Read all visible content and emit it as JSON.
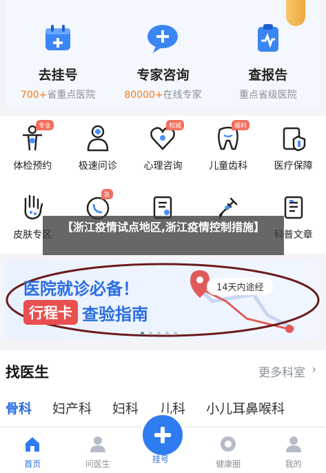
{
  "top_services": [
    {
      "title": "去挂号",
      "sub_highlight": "700+",
      "sub_text": "省重点医院",
      "icon": "calendar-plus-icon"
    },
    {
      "title": "专家咨询",
      "sub_highlight": "80000+",
      "sub_text": "在线专家",
      "icon": "chat-plus-icon"
    },
    {
      "title": "查报告",
      "sub_highlight": "",
      "sub_text": "重点省级医院",
      "icon": "report-icon"
    }
  ],
  "grid_items": [
    {
      "label": "体检预约",
      "badge": "专业",
      "icon": "body-check-icon"
    },
    {
      "label": "极速问诊",
      "badge": "",
      "icon": "doctor-icon"
    },
    {
      "label": "心理咨询",
      "badge": "权威",
      "icon": "heart-icon"
    },
    {
      "label": "儿童齿科",
      "badge": "福利",
      "icon": "tooth-icon"
    },
    {
      "label": "医疗保障",
      "badge": "",
      "icon": "shield-icon"
    },
    {
      "label": "皮肤专区",
      "badge": "",
      "icon": "hand-icon"
    },
    {
      "label": "",
      "badge": "急",
      "icon": "phone-icon"
    },
    {
      "label": "",
      "badge": "",
      "icon": "clipboard-icon"
    },
    {
      "label": "",
      "badge": "",
      "icon": "syringe-icon"
    },
    {
      "label": "科普文章",
      "badge": "",
      "icon": "article-icon"
    }
  ],
  "overlay_text": "【浙江疫情试点地区,浙江疫情控制措施】",
  "banner": {
    "line1": "医院就诊必备！",
    "tag": "行程卡",
    "line2": "查验指南",
    "pill": "14天内途经"
  },
  "doctor_section": {
    "title": "找医生",
    "more": "更多科室",
    "tabs": [
      "骨科",
      "妇产科",
      "妇科",
      "儿科",
      "小儿耳鼻喉科"
    ]
  },
  "tabbar": {
    "items": [
      {
        "label": "首页",
        "icon": "home-icon"
      },
      {
        "label": "问医生",
        "icon": "doctor-icon"
      },
      {
        "label": "挂号",
        "icon": "plus-icon"
      },
      {
        "label": "健康圈",
        "icon": "circle-icon"
      },
      {
        "label": "我的",
        "icon": "user-icon"
      }
    ]
  },
  "colors": {
    "brand": "#2f7bf0",
    "accent": "#f27a1a",
    "tag": "#e94f4f"
  }
}
